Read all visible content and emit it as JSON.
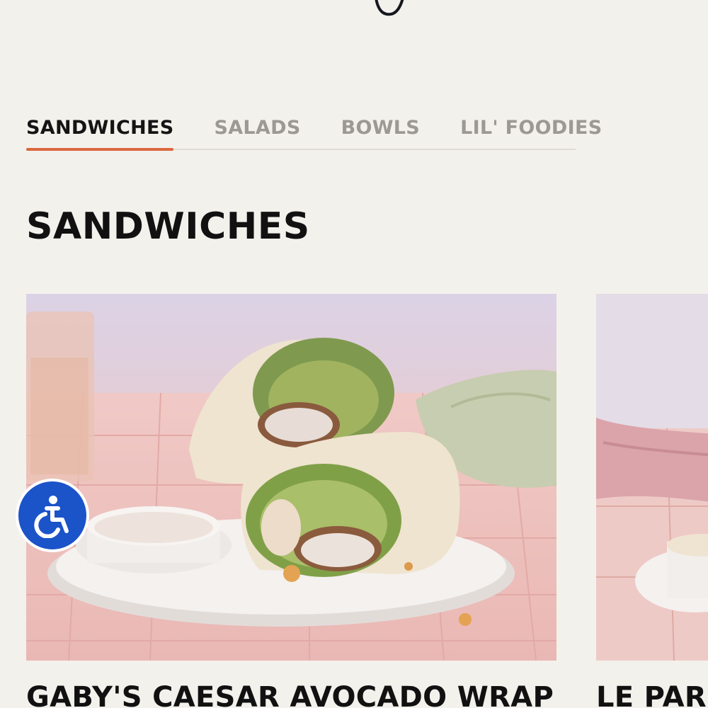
{
  "tabs": [
    {
      "label": "SANDWICHES",
      "active": true
    },
    {
      "label": "SALADS",
      "active": false
    },
    {
      "label": "BOWLS",
      "active": false
    },
    {
      "label": "LIL' FOODIES",
      "active": false
    }
  ],
  "section": {
    "title": "SANDWICHES"
  },
  "cards": [
    {
      "title": "GABY'S CAESAR AVOCADO WRAP",
      "image": "caesar-avocado-wrap-photo"
    },
    {
      "title": "LE PARI",
      "image": "le-pari-photo"
    }
  ],
  "accessibility": {
    "icon": "accessibility-icon",
    "color": "#1b53c9"
  },
  "colors": {
    "accent": "#d9683e",
    "background": "#f3f1ec",
    "active_tab": "#141414",
    "inactive_tab": "#9c9994"
  }
}
